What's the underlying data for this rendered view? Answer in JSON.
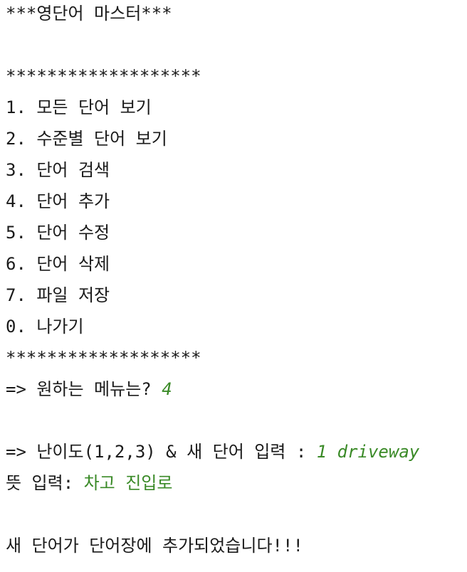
{
  "console": {
    "title": "***영단어 마스터***",
    "separator_top": "*******************",
    "menu_items": [
      "1. 모든 단어 보기",
      "2. 수준별 단어 보기",
      "3. 단어 검색",
      "4. 단어 추가",
      "5. 단어 수정",
      "6. 단어 삭제",
      "7. 파일 저장",
      "0. 나가기"
    ],
    "separator_bottom": "*******************",
    "menu_prompt": "=> 원하는 메뉴는? ",
    "menu_input": "4",
    "level_prompt": "=> 난이도(1,2,3) & 새 단어 입력 : ",
    "level_input": "1 driveway",
    "meaning_prompt": "뜻 입력: ",
    "meaning_input": "차고 진입로",
    "result_message": "새 단어가 단어장에 추가되었습니다!!!"
  }
}
